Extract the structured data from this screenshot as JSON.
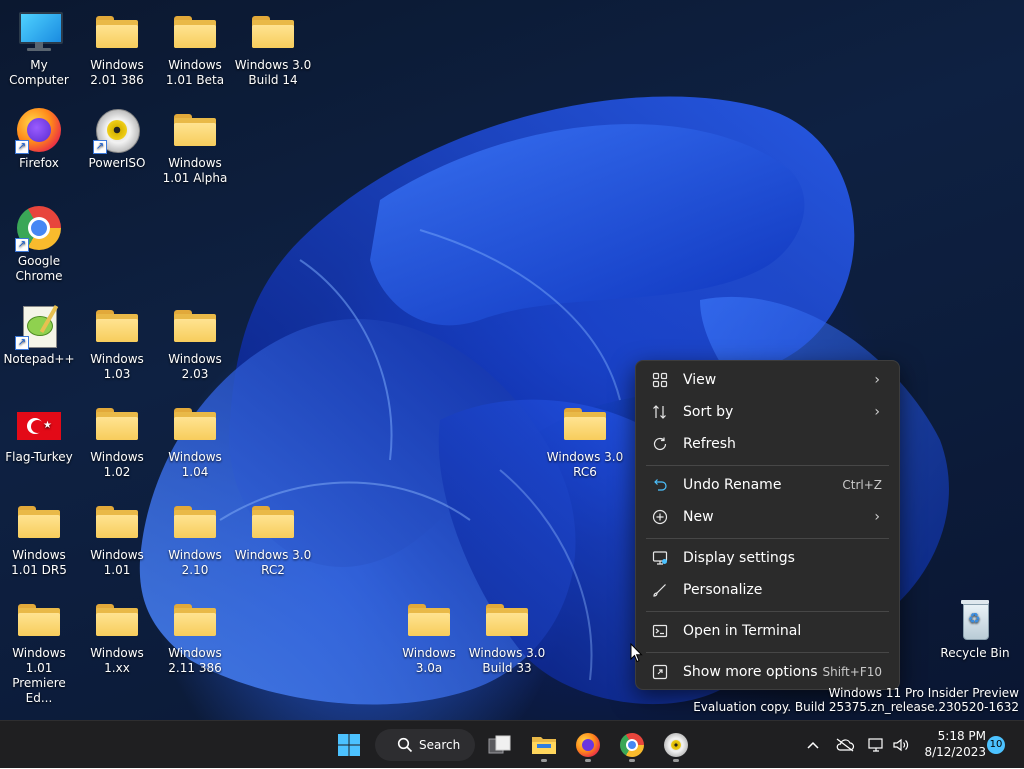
{
  "desktop_icons": [
    {
      "label": "My Computer",
      "type": "monitor"
    },
    {
      "label": "Windows 2.01 386",
      "type": "folder"
    },
    {
      "label": "Windows 1.01 Beta",
      "type": "folder"
    },
    {
      "label": "Windows 3.0 Build 14",
      "type": "folder"
    },
    {
      "label": "Firefox",
      "type": "firefox"
    },
    {
      "label": "PowerISO",
      "type": "poweriso"
    },
    {
      "label": "Windows 1.01 Alpha",
      "type": "folder"
    },
    {
      "label": "Google Chrome",
      "type": "chrome"
    },
    {
      "label": "Notepad++",
      "type": "notepad"
    },
    {
      "label": "Windows 1.03",
      "type": "folder"
    },
    {
      "label": "Windows 2.03",
      "type": "folder"
    },
    {
      "label": "Flag-Turkey",
      "type": "flag"
    },
    {
      "label": "Windows 1.02",
      "type": "folder"
    },
    {
      "label": "Windows 1.04",
      "type": "folder"
    },
    {
      "label": "Windows 3.0 RC6",
      "type": "folder"
    },
    {
      "label": "Windows 1.01 DR5",
      "type": "folder"
    },
    {
      "label": "Windows 1.01",
      "type": "folder"
    },
    {
      "label": "Windows 2.10",
      "type": "folder"
    },
    {
      "label": "Windows 3.0 RC2",
      "type": "folder"
    },
    {
      "label": "Windows 1.01 Premiere Ed...",
      "type": "folder"
    },
    {
      "label": "Windows 1.xx",
      "type": "folder"
    },
    {
      "label": "Windows 2.11 386",
      "type": "folder"
    },
    {
      "label": "Windows 3.0a",
      "type": "folder"
    },
    {
      "label": "Windows 3.0 Build 33",
      "type": "folder"
    },
    {
      "label": "Recycle Bin",
      "type": "recycle"
    }
  ],
  "context_menu": {
    "items": [
      {
        "label": "View",
        "icon": "grid-icon",
        "submenu": true
      },
      {
        "label": "Sort by",
        "icon": "sort-icon",
        "submenu": true
      },
      {
        "label": "Refresh",
        "icon": "refresh-icon"
      },
      {
        "label": "Undo Rename",
        "icon": "undo-icon",
        "shortcut": "Ctrl+Z"
      },
      {
        "label": "New",
        "icon": "plus-circle-icon",
        "submenu": true
      },
      {
        "label": "Display settings",
        "icon": "display-icon"
      },
      {
        "label": "Personalize",
        "icon": "brush-icon"
      },
      {
        "label": "Open in Terminal",
        "icon": "terminal-icon"
      },
      {
        "label": "Show more options",
        "icon": "more-options-icon",
        "shortcut": "Shift+F10"
      }
    ]
  },
  "watermark": {
    "line1": "Windows 11 Pro Insider Preview",
    "line2": "Evaluation copy. Build 25375.zn_release.230520-1632"
  },
  "taskbar": {
    "search_label": "Search",
    "time": "5:18 PM",
    "date": "8/12/2023",
    "notification_count": "10"
  },
  "colors": {
    "menu_bg": "#2b2b2b",
    "taskbar_bg": "#1f1f21",
    "accent": "#4cc2ff",
    "folder": "#f7cd5c"
  }
}
